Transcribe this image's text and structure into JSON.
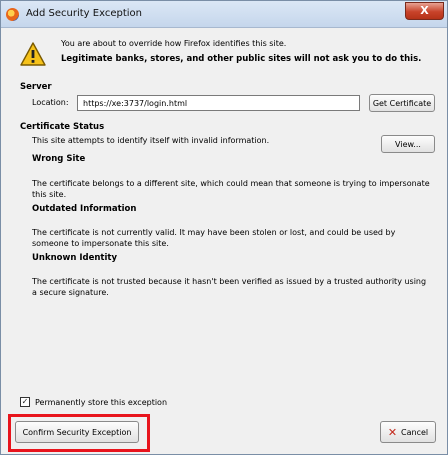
{
  "window": {
    "title": "Add Security Exception",
    "close_label": "X"
  },
  "intro": {
    "line1": "You are about to override how Firefox identifies this site.",
    "line2": "Legitimate banks, stores, and other public sites will not ask you to do this."
  },
  "server": {
    "section_title": "Server",
    "location_label": "Location:",
    "location_value": "https://xe:3737/login.html",
    "get_certificate_label": "Get Certificate"
  },
  "certificate_status": {
    "section_title": "Certificate Status",
    "summary": "This site attempts to identify itself with invalid information.",
    "view_label": "View...",
    "items": [
      {
        "heading": "Wrong Site",
        "text": "The certificate belongs to a different site, which could mean that someone is trying to impersonate this site."
      },
      {
        "heading": "Outdated Information",
        "text": "The certificate is not currently valid. It may have been stolen or lost, and could be used by someone to impersonate this site."
      },
      {
        "heading": "Unknown Identity",
        "text": "The certificate is not trusted because it hasn't been verified as issued by a trusted authority using a secure signature."
      }
    ]
  },
  "permanent": {
    "checked": true,
    "label": "Permanently store this exception"
  },
  "footer": {
    "confirm_label": "Confirm Security Exception",
    "cancel_label": "Cancel"
  },
  "colors": {
    "highlight": "#e8141c",
    "title_close": "#c8432a"
  }
}
